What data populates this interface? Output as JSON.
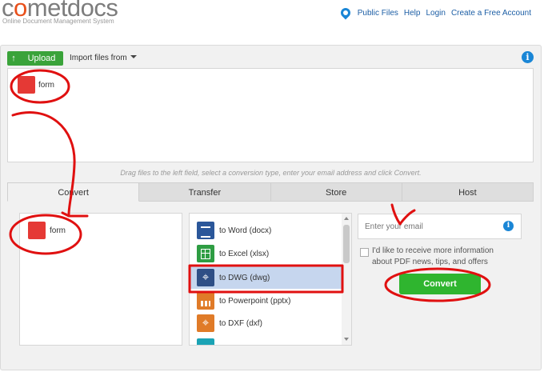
{
  "header": {
    "logo_prefix": "c",
    "logo_o": "o",
    "logo_suffix": "metdocs",
    "tagline": "Online Document Management System",
    "nav": {
      "public_files": "Public Files",
      "help": "Help",
      "login": "Login",
      "create_account": "Create a Free Account"
    }
  },
  "toolbar": {
    "upload_label": "Upload",
    "import_label": "Import files from"
  },
  "dropzone": {
    "file_name": "form"
  },
  "hint": "Drag files to the left field, select a conversion type, enter your email address and click Convert.",
  "tabs": [
    "Convert",
    "Transfer",
    "Store",
    "Host"
  ],
  "active_tab": "Convert",
  "convert_panel": {
    "file_name": "form",
    "conversions": [
      {
        "label": "to Word (docx)",
        "icon": "word-icon"
      },
      {
        "label": "to Excel (xlsx)",
        "icon": "excel-icon"
      },
      {
        "label": "to DWG (dwg)",
        "icon": "dwg-icon",
        "selected": true
      },
      {
        "label": "to Powerpoint (pptx)",
        "icon": "powerpoint-icon"
      },
      {
        "label": "to DXF (dxf)",
        "icon": "dxf-icon"
      }
    ],
    "email_placeholder": "Enter your email",
    "newsletter_label": "I'd like to receive more information about PDF news, tips, and offers",
    "convert_label": "Convert"
  },
  "colors": {
    "accent_blue": "#1a86d6",
    "upload_green": "#3aa33a",
    "convert_green": "#2fb52f",
    "selection": "#c6d6ee",
    "annotation_red": "#e01010"
  }
}
